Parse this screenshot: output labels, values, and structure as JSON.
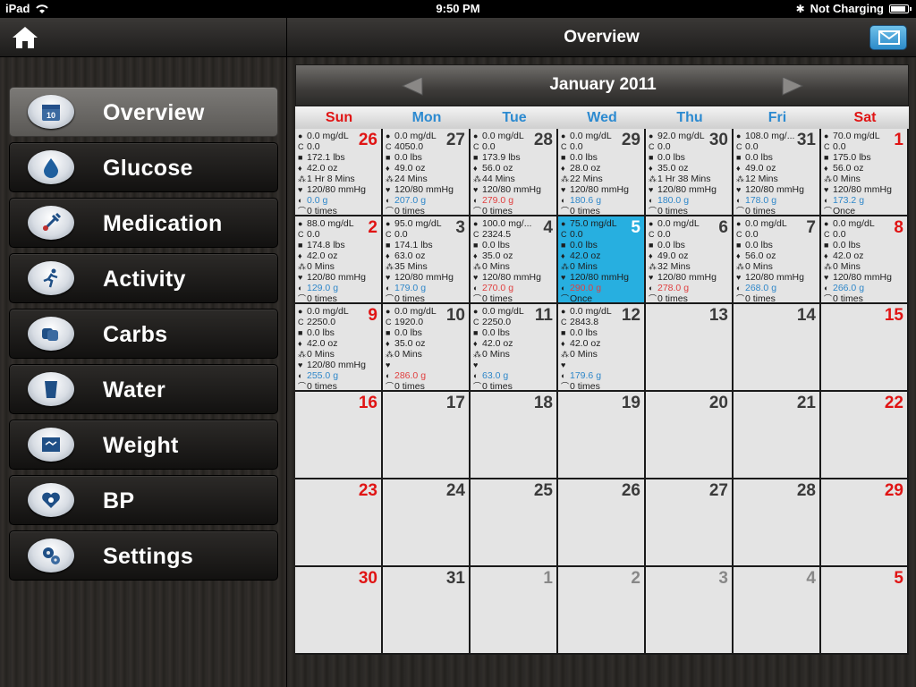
{
  "status_bar": {
    "device": "iPad",
    "time": "9:50 PM",
    "charging": "Not Charging"
  },
  "sidebar": {
    "items": [
      {
        "label": "Overview",
        "icon": "calendar-icon",
        "active": true
      },
      {
        "label": "Glucose",
        "icon": "drop-icon"
      },
      {
        "label": "Medication",
        "icon": "syringe-icon"
      },
      {
        "label": "Activity",
        "icon": "runner-icon"
      },
      {
        "label": "Carbs",
        "icon": "bread-icon"
      },
      {
        "label": "Water",
        "icon": "glass-icon"
      },
      {
        "label": "Weight",
        "icon": "scale-icon"
      },
      {
        "label": "BP",
        "icon": "heart-stethoscope-icon"
      },
      {
        "label": "Settings",
        "icon": "gears-icon"
      }
    ]
  },
  "header": {
    "title": "Overview"
  },
  "calendar": {
    "month": "January 2011",
    "weekdays": [
      "Sun",
      "Mon",
      "Tue",
      "Wed",
      "Thu",
      "Fri",
      "Sat"
    ],
    "selected_day": "5",
    "cells": [
      {
        "day": "26",
        "lines": [
          "0.0 mg/dL",
          "0.0",
          "172.1 lbs",
          "42.0 oz",
          "1 Hr 8 Mins",
          "120/80 mmHg",
          "0.0 g",
          "0 times"
        ]
      },
      {
        "day": "27",
        "lines": [
          "0.0 mg/dL",
          "4050.0",
          "0.0 lbs",
          "49.0 oz",
          "24 Mins",
          "120/80 mmHg",
          "207.0 g",
          "0 times"
        ]
      },
      {
        "day": "28",
        "lines": [
          "0.0 mg/dL",
          "0.0",
          "173.9 lbs",
          "56.0 oz",
          "44 Mins",
          "120/80 mmHg",
          "279.0 g",
          "0 times"
        ]
      },
      {
        "day": "29",
        "lines": [
          "0.0 mg/dL",
          "0.0",
          "0.0 lbs",
          "28.0 oz",
          "22 Mins",
          "120/80 mmHg",
          "180.6 g",
          "0 times"
        ]
      },
      {
        "day": "30",
        "lines": [
          "92.0 mg/dL",
          "0.0",
          "0.0 lbs",
          "35.0 oz",
          "1 Hr 38 Mins",
          "120/80 mmHg",
          "180.0 g",
          "0 times"
        ]
      },
      {
        "day": "31",
        "lines": [
          "108.0 mg/...",
          "0.0",
          "0.0 lbs",
          "49.0 oz",
          "12 Mins",
          "120/80 mmHg",
          "178.0 g",
          "0 times"
        ]
      },
      {
        "day": "1",
        "lines": [
          "70.0 mg/dL",
          "0.0",
          "175.0 lbs",
          "56.0 oz",
          "0 Mins",
          "120/80 mmHg",
          "173.2 g",
          "Once"
        ]
      },
      {
        "day": "2",
        "lines": [
          "88.0 mg/dL",
          "0.0",
          "174.8 lbs",
          "42.0 oz",
          "0 Mins",
          "120/80 mmHg",
          "129.0 g",
          "0 times"
        ]
      },
      {
        "day": "3",
        "lines": [
          "95.0 mg/dL",
          "0.0",
          "174.1 lbs",
          "63.0 oz",
          "35 Mins",
          "120/80 mmHg",
          "179.0 g",
          "0 times"
        ]
      },
      {
        "day": "4",
        "lines": [
          "100.0 mg/...",
          "2324.5",
          "0.0 lbs",
          "35.0 oz",
          "0 Mins",
          "120/80 mmHg",
          "270.0 g",
          "0 times"
        ]
      },
      {
        "day": "5",
        "lines": [
          "75.0 mg/dL",
          "0.0",
          "0.0 lbs",
          "42.0 oz",
          "0 Mins",
          "120/80 mmHg",
          "290.0 g",
          "Once"
        ]
      },
      {
        "day": "6",
        "lines": [
          "0.0 mg/dL",
          "0.0",
          "0.0 lbs",
          "49.0 oz",
          "32 Mins",
          "120/80 mmHg",
          "278.0 g",
          "0 times"
        ]
      },
      {
        "day": "7",
        "lines": [
          "0.0 mg/dL",
          "0.0",
          "0.0 lbs",
          "56.0 oz",
          "0 Mins",
          "120/80 mmHg",
          "268.0 g",
          "0 times"
        ]
      },
      {
        "day": "8",
        "lines": [
          "0.0 mg/dL",
          "0.0",
          "0.0 lbs",
          "42.0 oz",
          "0 Mins",
          "120/80 mmHg",
          "266.0 g",
          "0 times"
        ]
      },
      {
        "day": "9",
        "lines": [
          "0.0 mg/dL",
          "2250.0",
          "0.0 lbs",
          "42.0 oz",
          "0 Mins",
          "120/80 mmHg",
          "255.0 g",
          "0 times"
        ]
      },
      {
        "day": "10",
        "lines": [
          "0.0 mg/dL",
          "1920.0",
          "0.0 lbs",
          "35.0 oz",
          "0 Mins",
          "",
          "286.0 g",
          "0 times"
        ]
      },
      {
        "day": "11",
        "lines": [
          "0.0 mg/dL",
          "2250.0",
          "0.0 lbs",
          "42.0 oz",
          "0 Mins",
          "",
          "63.0 g",
          "0 times"
        ]
      },
      {
        "day": "12",
        "lines": [
          "0.0 mg/dL",
          "2843.8",
          "0.0 lbs",
          "42.0 oz",
          "0 Mins",
          "",
          "179.6 g",
          "0 times"
        ]
      },
      {
        "day": "13",
        "lines": []
      },
      {
        "day": "14",
        "lines": []
      },
      {
        "day": "15",
        "lines": []
      },
      {
        "day": "16",
        "lines": []
      },
      {
        "day": "17",
        "lines": []
      },
      {
        "day": "18",
        "lines": []
      },
      {
        "day": "19",
        "lines": []
      },
      {
        "day": "20",
        "lines": []
      },
      {
        "day": "21",
        "lines": []
      },
      {
        "day": "22",
        "lines": []
      },
      {
        "day": "23",
        "lines": []
      },
      {
        "day": "24",
        "lines": []
      },
      {
        "day": "25",
        "lines": []
      },
      {
        "day": "26",
        "lines": []
      },
      {
        "day": "27",
        "lines": []
      },
      {
        "day": "28",
        "lines": []
      },
      {
        "day": "29",
        "lines": []
      },
      {
        "day": "30",
        "lines": []
      },
      {
        "day": "31",
        "lines": []
      },
      {
        "day": "1",
        "lines": []
      },
      {
        "day": "2",
        "lines": []
      },
      {
        "day": "3",
        "lines": []
      },
      {
        "day": "4",
        "lines": []
      },
      {
        "day": "5",
        "lines": []
      }
    ]
  },
  "colors": {
    "accent": "#27afe0",
    "weekend": "#e01414",
    "weekday": "#2c8ad0"
  },
  "line_icons": [
    "drop-icon",
    "carbs-icon",
    "scale-icon",
    "water-icon",
    "runner-icon",
    "bp-icon",
    "food-icon",
    "syringe-icon"
  ]
}
